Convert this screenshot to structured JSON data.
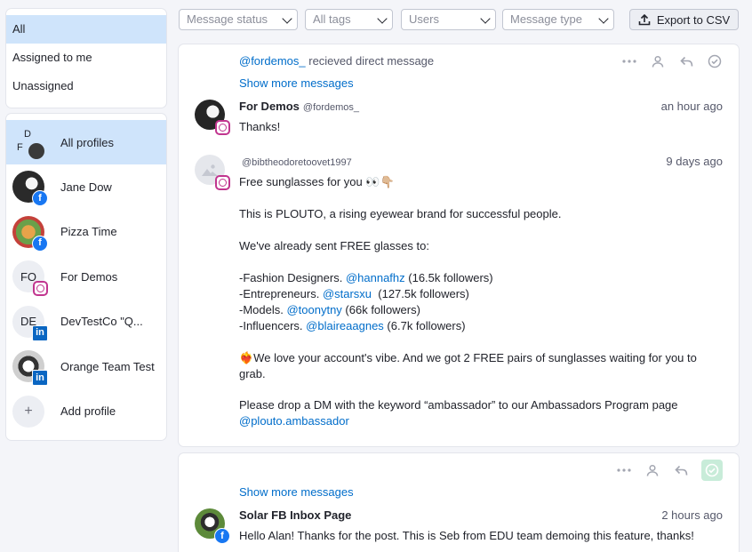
{
  "filters": {
    "items": [
      "All",
      "Assigned to me",
      "Unassigned"
    ]
  },
  "profiles": {
    "all_label": "All profiles",
    "all_initials": [
      "D",
      "F"
    ],
    "items": [
      {
        "name": "Jane Dow",
        "network": "facebook"
      },
      {
        "name": "Pizza Time",
        "network": "facebook"
      },
      {
        "name": "For Demos",
        "initials": "FO",
        "network": "instagram"
      },
      {
        "name": "DevTestCo \"Q...",
        "initials": "DE",
        "network": "linkedin"
      },
      {
        "name": "Orange Team Test",
        "network": "linkedin"
      }
    ],
    "add_label": "Add profile",
    "add_symbol": "+"
  },
  "toolbar": {
    "message_status": "Message status",
    "all_tags": "All tags",
    "users": "Users",
    "message_type": "Message type",
    "export_label": "Export to CSV"
  },
  "card1": {
    "info_handle": "@fordemos_",
    "info_text": " recieved direct message",
    "show_more": "Show more messages",
    "msg1": {
      "name": "For Demos",
      "handle": "@fordemos_",
      "time": "an hour ago",
      "text": "Thanks!"
    },
    "msg2": {
      "handle": "@bibtheodoretoovet1997",
      "time": "9 days ago",
      "line1": "Free sunglasses for you 👀👇🏼",
      "line2": "This is PLOUTO, a rising eyewear brand for successful people.",
      "line3": "We've already sent FREE glasses to:",
      "l4a": "-Fashion Designers. ",
      "l4b": "@hannafhz",
      "l4c": " (16.5k followers)",
      "l5a": "-Entrepreneurs. ",
      "l5b": "@starsxu",
      "l5c": "  (127.5k followers)",
      "l6a": "-Models. ",
      "l6b": "@toonytny",
      "l6c": " (66k followers)",
      "l7a": "-Influencers. ",
      "l7b": "@blaireaagnes",
      "l7c": " (6.7k followers)",
      "line8": "❤️‍🔥We love your account's vibe. And we got 2 FREE pairs of sunglasses waiting for you to grab.",
      "line9": "Please drop a DM with the keyword “ambassador” to our Ambassadors Program page",
      "line10": "@plouto.ambassador"
    }
  },
  "card2": {
    "show_more": "Show more messages",
    "msg": {
      "name": "Solar FB Inbox Page",
      "time": "2 hours ago",
      "text": "Hello Alan! Thanks for the post. This is Seb from EDU team demoing this feature, thanks!"
    }
  },
  "colors": {
    "accent": "#006dca",
    "active_bg": "#cfe4fb",
    "facebook": "#1877f2",
    "instagram": "#c1358f",
    "linkedin": "#0a66c2",
    "done": "#c8ecd9"
  },
  "icons": {
    "more": "more-horizontal-icon",
    "assign": "user-icon",
    "reply": "reply-icon",
    "done": "check-circle-icon",
    "export": "upload-icon"
  }
}
